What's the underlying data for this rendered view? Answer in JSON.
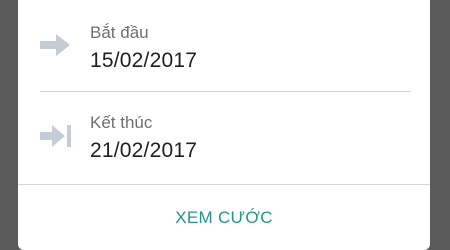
{
  "start": {
    "label": "Bắt đầu",
    "date": "15/02/2017",
    "icon": "arrow-right-icon"
  },
  "end": {
    "label": "Kết thúc",
    "date": "21/02/2017",
    "icon": "arrow-right-to-bar-icon"
  },
  "action": {
    "label": "XEM CƯỚC"
  },
  "colors": {
    "accent": "#21968a",
    "icon": "#c6ccd6",
    "backdrop": "#5b5b5b"
  }
}
